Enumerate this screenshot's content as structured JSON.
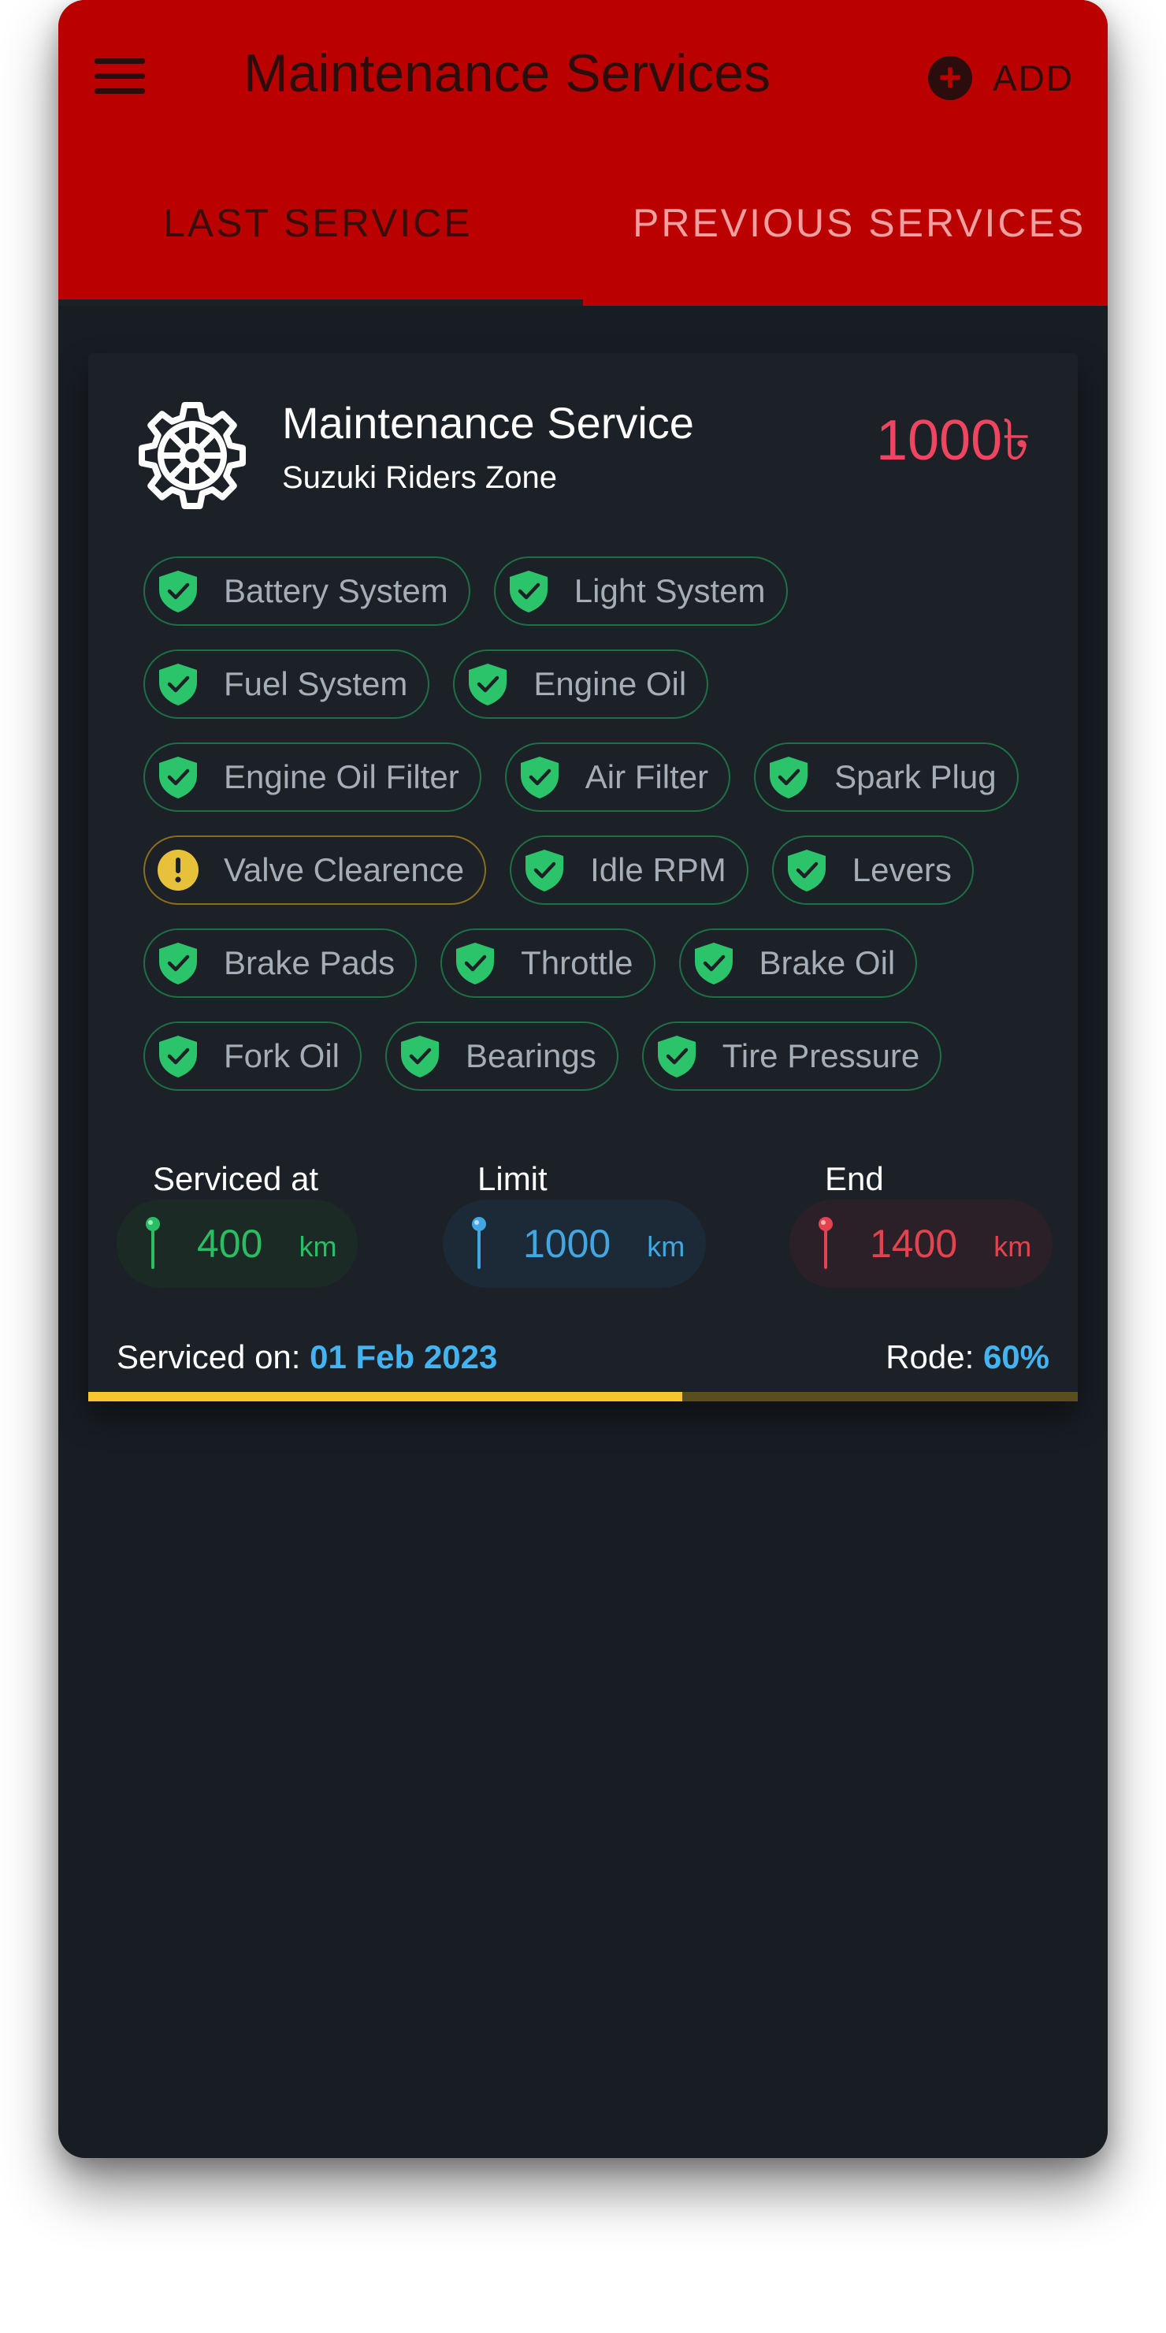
{
  "app_bar": {
    "title": "Maintenance Services",
    "add_label": "ADD",
    "background": "#bb0000"
  },
  "tabs": [
    {
      "label": "LAST SERVICE",
      "selected": true
    },
    {
      "label": "PREVIOUS SERVICES",
      "selected": false
    }
  ],
  "card": {
    "icon": "gear-icon",
    "title": "Maintenance Service",
    "subtitle": "Suzuki Riders Zone",
    "price": "1000৳",
    "checklist": [
      [
        {
          "label": "Battery System",
          "status": "ok"
        },
        {
          "label": "Light System",
          "status": "ok"
        }
      ],
      [
        {
          "label": "Fuel System",
          "status": "ok"
        },
        {
          "label": "Engine Oil",
          "status": "ok"
        }
      ],
      [
        {
          "label": "Engine Oil Filter",
          "status": "ok"
        },
        {
          "label": "Air Filter",
          "status": "ok"
        },
        {
          "label": "Spark Plug",
          "status": "ok"
        }
      ],
      [
        {
          "label": "Valve Clearence",
          "status": "warning"
        },
        {
          "label": "Idle RPM",
          "status": "ok"
        },
        {
          "label": "Levers",
          "status": "ok"
        }
      ],
      [
        {
          "label": "Brake Pads",
          "status": "ok"
        },
        {
          "label": "Throttle",
          "status": "ok"
        },
        {
          "label": "Brake Oil",
          "status": "ok"
        }
      ],
      [
        {
          "label": "Fork Oil",
          "status": "ok"
        },
        {
          "label": "Bearings",
          "status": "ok"
        },
        {
          "label": "Tire Pressure",
          "status": "ok"
        }
      ]
    ],
    "odometer": {
      "serviced_at": {
        "label": "Serviced at",
        "value": "400",
        "unit": "km",
        "color": "#2bbd63"
      },
      "limit": {
        "label": "Limit",
        "value": "1000",
        "unit": "km",
        "color": "#43a6e0"
      },
      "end": {
        "label": "End",
        "value": "1400",
        "unit": "km",
        "color": "#e2434f"
      }
    },
    "serviced_on_label": "Serviced on:",
    "serviced_on_date": "01 Feb 2023",
    "rode_label": "Rode:",
    "rode_value": "60%",
    "rode_fraction": 0.6
  },
  "colors": {
    "ok": "#2cc46a",
    "warning": "#e8c13a",
    "accent_blue": "#43b4f2",
    "progress": "#f7c62e"
  }
}
